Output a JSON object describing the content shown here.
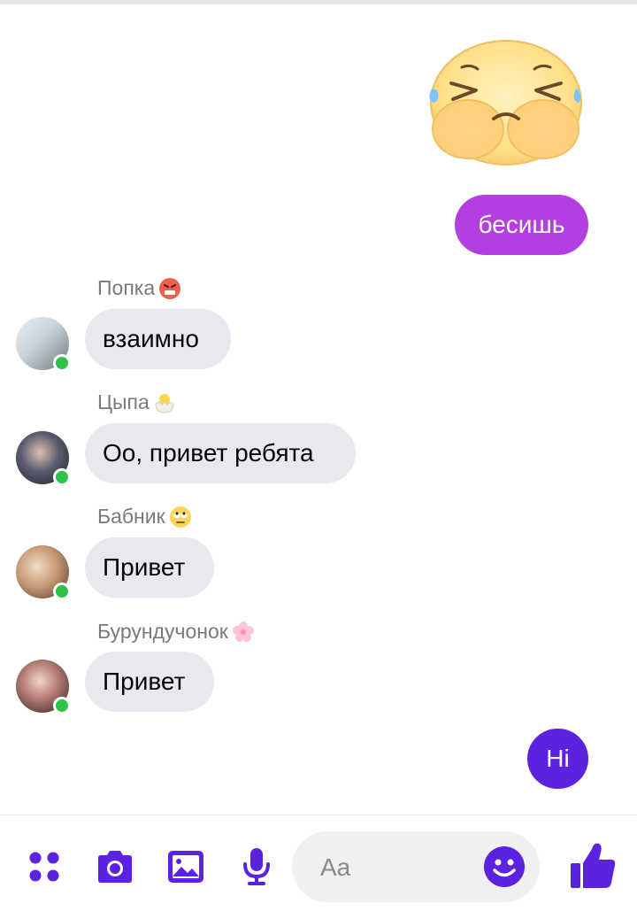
{
  "conversation": {
    "messages": [
      {
        "id": "m1",
        "direction": "out",
        "text": "бесишь"
      },
      {
        "id": "m2",
        "direction": "in",
        "sender": "Попка",
        "text": "взаимно"
      },
      {
        "id": "m3",
        "direction": "in",
        "sender": "Цыпа",
        "text": "Оо, привет ребята"
      },
      {
        "id": "m4",
        "direction": "in",
        "sender": "Бабник",
        "text": "Привет"
      },
      {
        "id": "m5",
        "direction": "in",
        "sender": "Бурундучонок",
        "text": "Привет"
      },
      {
        "id": "m6",
        "direction": "out",
        "text": "Hi"
      }
    ]
  },
  "sender_emojis": {
    "Попка": "angry-face-emoji",
    "Цыпа": "hatching-chick-emoji",
    "Бабник": "eye-roll-emoji",
    "Бурундучонок": "cherry-blossom-emoji"
  },
  "composer": {
    "placeholder": "Aa",
    "tools": [
      "apps-icon",
      "camera-icon",
      "gallery-icon",
      "microphone-icon"
    ],
    "send_icon": "thumbs-up-icon",
    "emoji_icon": "smiley-icon"
  },
  "colors": {
    "accent": "#5b22e0",
    "bubble_purple": "#b33fe0",
    "bubble_incoming": "#e9e8ee",
    "online": "#2fc24b"
  }
}
